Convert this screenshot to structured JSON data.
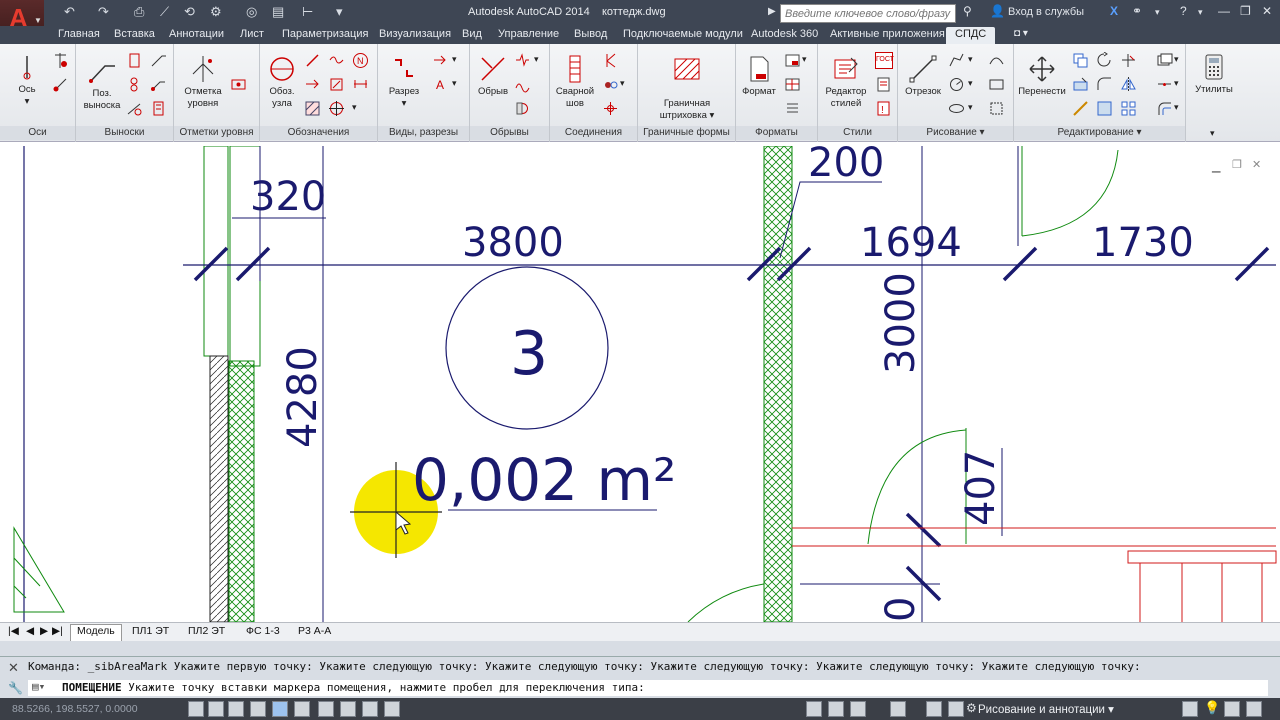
{
  "title_bar": {
    "app_title": "Autodesk AutoCAD 2014",
    "file_name": "коттедж.dwg",
    "search_placeholder": "Введите ключевое слово/фразу",
    "signin_label": "Вход в службы"
  },
  "ribbon_tabs": [
    {
      "label": "Главная"
    },
    {
      "label": "Вставка"
    },
    {
      "label": "Аннотации"
    },
    {
      "label": "Лист"
    },
    {
      "label": "Параметризация"
    },
    {
      "label": "Визуализация"
    },
    {
      "label": "Вид"
    },
    {
      "label": "Управление"
    },
    {
      "label": "Вывод"
    },
    {
      "label": "Подключаемые модули"
    },
    {
      "label": "Autodesk 360"
    },
    {
      "label": "Активные приложения"
    },
    {
      "label": "СПДС",
      "active": true
    }
  ],
  "ribbon_panels": [
    {
      "label": "Оси"
    },
    {
      "label": "Выноски"
    },
    {
      "label": "Отметки уровня"
    },
    {
      "label": "Обозначения"
    },
    {
      "label": "Виды, разрезы"
    },
    {
      "label": "Обрывы"
    },
    {
      "label": "Соединения"
    },
    {
      "label": "Граничные формы"
    },
    {
      "label": "Форматы"
    },
    {
      "label": "Стили"
    },
    {
      "label": "Рисование ▾"
    },
    {
      "label": "Редактирование ▾"
    }
  ],
  "ribbon_buttons": {
    "axis": "Ось",
    "pos_leader_line1": "Поз.",
    "pos_leader_line2": "выноска",
    "level_mark_line1": "Отметка",
    "level_mark_line2": "уровня",
    "node_line1": "Обоз.",
    "node_line2": "узла",
    "section": "Разрез",
    "break": "Обрыв",
    "weld_line1": "Сварной",
    "weld_line2": "шов",
    "hatch_line1": "Граничная",
    "hatch_line2": "штриховка",
    "format": "Формат",
    "style_editor_line1": "Редактор",
    "style_editor_line2": "стилей",
    "segment": "Отрезок",
    "move": "Перенести",
    "utilities": "Утилиты",
    "gost_badge": "ГОСТ"
  },
  "drawing": {
    "dimensions": [
      "320",
      "3800",
      "200",
      "1694",
      "1730",
      "4280",
      "3000",
      "407",
      "0"
    ],
    "room_number": "3",
    "room_area": "0,002 m²"
  },
  "layout_tabs": [
    {
      "label": "Модель",
      "active": true
    },
    {
      "label": "ПЛ1 ЭТ"
    },
    {
      "label": "ПЛ2 ЭТ"
    },
    {
      "label": "ФС 1-3"
    },
    {
      "label": "Р3 А-А"
    }
  ],
  "command": {
    "history": "Команда: _sibAreaMark Укажите первую точку: Укажите следующую точку: Укажите следующую точку: Укажите следующую точку: Укажите следующую точку: Укажите следующую точку:",
    "prompt_keyword": "ПОМЕЩЕНИЕ",
    "prompt_text": "Укажите точку вставки маркера помещения, нажмите пробел для переключения типа:"
  },
  "status_bar": {
    "coordinates": "88.5266, 198.5527, 0.0000",
    "workspace": "Рисование и аннотации"
  },
  "colors": {
    "titlebar_bg": "#3e4654",
    "drawing_lines": "#1a1a6e",
    "wall_hatch": "#0f8a0f",
    "red_lines": "#d11a1a",
    "cursor_highlight": "#f5e700"
  }
}
